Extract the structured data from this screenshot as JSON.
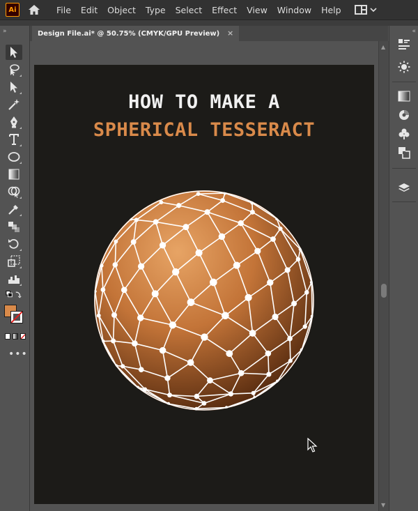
{
  "app": {
    "logo_text": "Ai"
  },
  "menu": {
    "items": [
      "File",
      "Edit",
      "Object",
      "Type",
      "Select",
      "Effect",
      "View",
      "Window",
      "Help"
    ]
  },
  "document": {
    "tab_title": "Design File.ai* @ 50.75% (CMYK/GPU Preview)",
    "close_glyph": "×"
  },
  "artwork": {
    "line1": "HOW TO MAKE A",
    "line2": "SPHERICAL TESSERACT"
  },
  "colors": {
    "artboard_bg": "#1c1b18",
    "sphere_light": "#d99456",
    "sphere_dark": "#5a2c0e",
    "title_white": "#f1f1f1",
    "title_orange": "#d98a4a",
    "fill_swatch": "#d98a4a"
  },
  "tools": [
    "selection-tool",
    "direct-select-lasso-tool",
    "direct-selection-tool",
    "magic-wand-tool",
    "pen-tool",
    "type-tool",
    "ellipse-tool",
    "gradient-tool",
    "shape-builder-tool",
    "eyedropper-tool",
    "blend-tool",
    "rotate-tool",
    "scale-tool",
    "graph-tool"
  ],
  "right_panels": [
    "properties-icon",
    "appearance-icon",
    "gradient-icon",
    "color-icon",
    "symbols-icon",
    "pathfinder-icon",
    "layers-icon"
  ]
}
